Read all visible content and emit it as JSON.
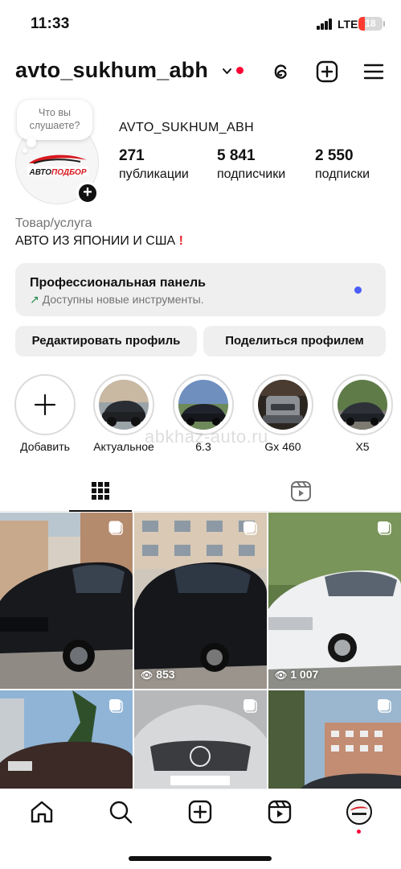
{
  "status_bar": {
    "time": "11:33",
    "network": "LTE",
    "battery": "18"
  },
  "header": {
    "username": "avto_sukhum_abh"
  },
  "profile": {
    "note": "Что вы слушаете?",
    "display_name": "AVTO_SUKHUM_ABH",
    "stats": [
      {
        "value": "271",
        "label": "публикации"
      },
      {
        "value": "5 841",
        "label": "подписчики"
      },
      {
        "value": "2 550",
        "label": "подписки"
      }
    ],
    "category": "Товар/услуга",
    "bio": "АВТО ИЗ ЯПОНИИ И США",
    "bio_emoji": "!",
    "logo_text": "АВТОПОДБОР"
  },
  "pro_panel": {
    "title": "Профессиональная панель",
    "subtitle": "Доступны новые инструменты."
  },
  "buttons": {
    "edit": "Редактировать профиль",
    "share": "Поделиться профилем"
  },
  "highlights": [
    {
      "label": "Добавить"
    },
    {
      "label": "Актуальное"
    },
    {
      "label": "6.3"
    },
    {
      "label": "Gx 460"
    },
    {
      "label": "X5"
    }
  ],
  "watermark": "abkhaz-auto.ru",
  "grid": [
    {
      "views": ""
    },
    {
      "views": "853"
    },
    {
      "views": "1 007"
    },
    {
      "views": ""
    },
    {
      "views": ""
    },
    {
      "views": ""
    }
  ],
  "colors": {
    "accent_blue": "#4a5df9",
    "notification_red": "#ff0034",
    "panel_bg": "#efefef"
  }
}
